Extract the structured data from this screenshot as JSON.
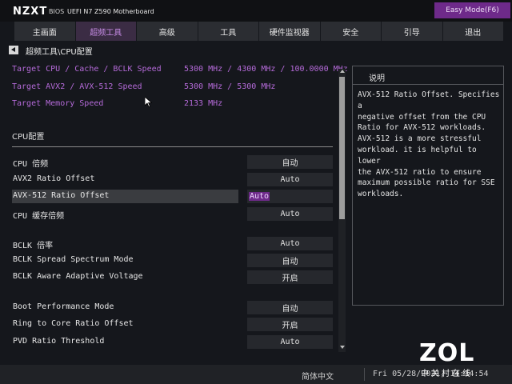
{
  "header": {
    "brand": "NZXT",
    "bios": "BIOS",
    "model": "UEFI N7 Z590 Motherboard",
    "mode_button": "Easy Mode(F6)"
  },
  "menu": {
    "items": [
      {
        "label": "主画面"
      },
      {
        "label": "超频工具"
      },
      {
        "label": "高级"
      },
      {
        "label": "工具"
      },
      {
        "label": "硬件监视器"
      },
      {
        "label": "安全"
      },
      {
        "label": "引导"
      },
      {
        "label": "退出"
      }
    ],
    "active_index": 1
  },
  "breadcrumb": "超频工具\\CPU配置",
  "targets": [
    {
      "label": "Target CPU / Cache / BCLK Speed",
      "value": "5300 MHz / 4300 MHz / 100.0000 MHz"
    },
    {
      "label": "Target AVX2 / AVX-512 Speed",
      "value": "5300 MHz / 5300 MHz"
    },
    {
      "label": "Target Memory Speed",
      "value": "2133 MHz"
    }
  ],
  "section": {
    "title": "CPU配置"
  },
  "settings": [
    {
      "label": "CPU  倍频",
      "value": "自动"
    },
    {
      "label": "AVX2 Ratio Offset",
      "value": "Auto"
    },
    {
      "label": "AVX-512 Ratio Offset",
      "value": "Auto",
      "selected": true
    },
    {
      "label": "CPU  缓存倍频",
      "value": "Auto"
    },
    {
      "label": "BCLK 倍率",
      "value": "Auto"
    },
    {
      "label": "BCLK Spread Spectrum Mode",
      "value": "自动"
    },
    {
      "label": "BCLK Aware Adaptive Voltage",
      "value": "开启"
    },
    {
      "label": "Boot Performance Mode",
      "value": "自动"
    },
    {
      "label": "Ring to Core Ratio Offset",
      "value": "开启"
    },
    {
      "label": "PVD Ratio Threshold",
      "value": "Auto"
    }
  ],
  "help": {
    "title": "说明",
    "text": "AVX-512 Ratio Offset. Specifies a\nnegative offset from the CPU\nRatio for AVX-512 workloads.\nAVX-512 is a more stressful\nworkload. it is helpful to lower\nthe AVX-512 ratio to ensure\nmaximum possible ratio for SSE\nworkloads."
  },
  "footer": {
    "language": "简体中文",
    "datetime": "Fri 05/28/2021, 14:14:54"
  },
  "watermark": {
    "logo": "ZOL",
    "sub": "中关村在线"
  },
  "colors": {
    "accent": "#b46ad8",
    "mode_button": "#6e2a8a",
    "background": "#15171c"
  }
}
